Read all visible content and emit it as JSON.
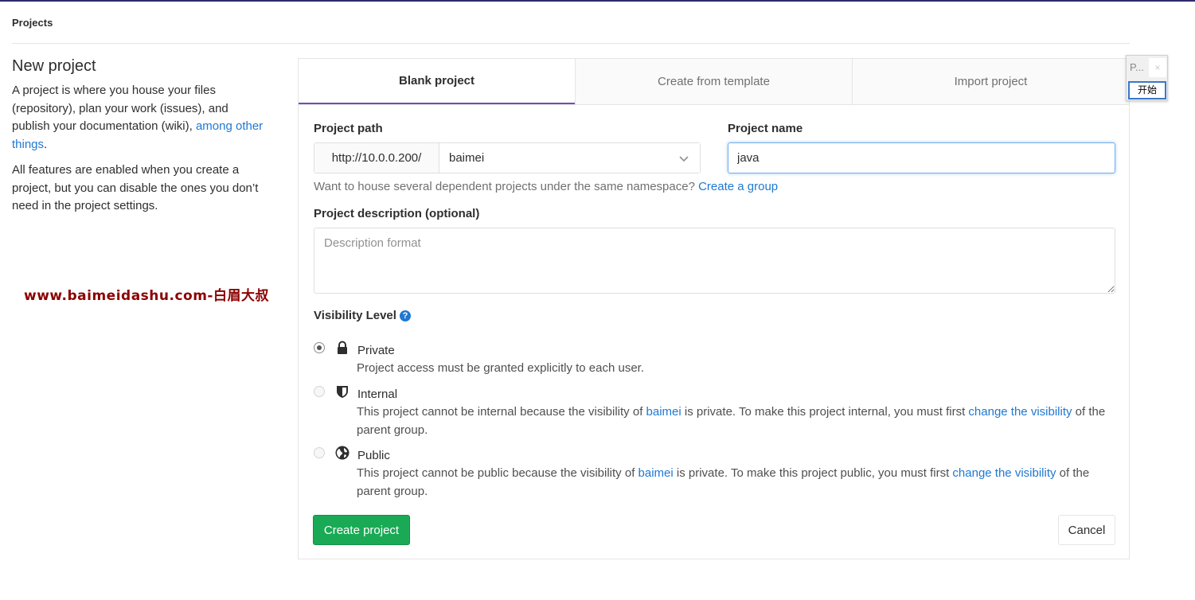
{
  "breadcrumb": "Projects",
  "intro": {
    "title": "New project",
    "p1_text": "A project is where you house your files (repository), plan your work (issues), and publish your documentation (wiki), ",
    "p1_link": "among other things",
    "p1_end": ".",
    "p2": "All features are enabled when you create a project, but you can disable the ones you don’t need in the project settings."
  },
  "watermark": "www.baimeidashu.com-白眉大叔",
  "tabs": [
    "Blank project",
    "Create from template",
    "Import project"
  ],
  "form": {
    "path_label": "Project path",
    "path_prefix": "http://10.0.0.200/",
    "namespace": "baimei",
    "name_label": "Project name",
    "name_value": "java",
    "hint_text": "Want to house several dependent projects under the same namespace? ",
    "hint_link": "Create a group",
    "desc_label": "Project description (optional)",
    "desc_placeholder": "Description format",
    "visibility_label": "Visibility Level",
    "help_icon": "?"
  },
  "visibility": {
    "private": {
      "title": "Private",
      "desc": "Project access must be granted explicitly to each user."
    },
    "internal": {
      "title": "Internal",
      "desc_a": "This project cannot be internal because the visibility of ",
      "desc_group": "baimei",
      "desc_b": " is private. To make this project internal, you must first ",
      "desc_link": "change the visibility",
      "desc_c": " of the parent group."
    },
    "public": {
      "title": "Public",
      "desc_a": "This project cannot be public because the visibility of ",
      "desc_group": "baimei",
      "desc_b": " is private. To make this project public, you must first ",
      "desc_link": "change the visibility",
      "desc_c": " of the parent group."
    }
  },
  "buttons": {
    "create": "Create project",
    "cancel": "Cancel"
  },
  "widget": {
    "title": "P...",
    "close": "×",
    "start": "开始"
  },
  "colors": {
    "accent": "#1f78d1",
    "create_button": "#1aaa55",
    "active_tab_underline": "#6b4fbb",
    "watermark": "#8b0000"
  }
}
